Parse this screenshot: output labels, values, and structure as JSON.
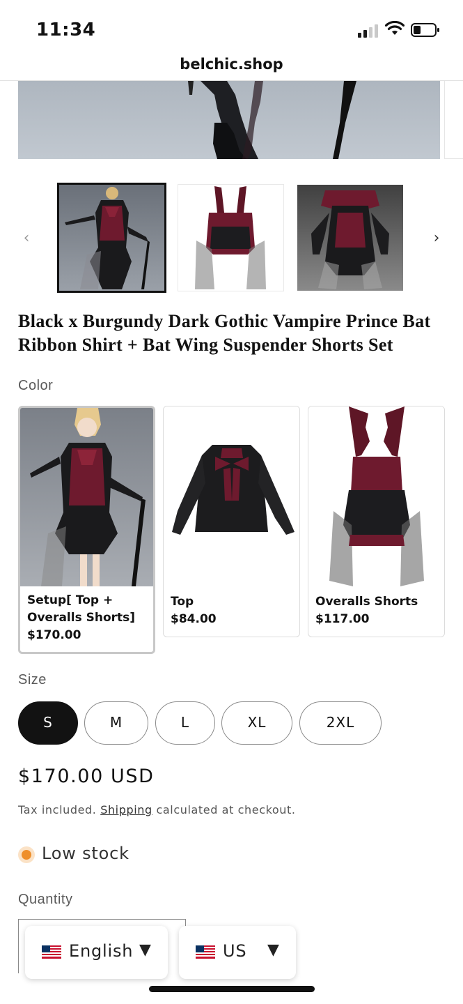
{
  "status_bar": {
    "time": "11:34"
  },
  "browser": {
    "url": "belchic.shop"
  },
  "gallery": {
    "prev_icon": "chevron-left-icon",
    "next_icon": "chevron-right-icon",
    "thumbnails": [
      "thumbnail-1",
      "thumbnail-2",
      "thumbnail-3"
    ]
  },
  "product": {
    "title": "Black x Burgundy Dark Gothic Vampire Prince Bat Ribbon Shirt + Bat Wing Suspender Shorts Set"
  },
  "color": {
    "label": "Color",
    "options": [
      {
        "name": "Setup[ Top + Overalls Shorts]",
        "price": "$170.00",
        "selected": true
      },
      {
        "name": "Top",
        "price": "$84.00",
        "selected": false
      },
      {
        "name": "Overalls Shorts",
        "price": "$117.00",
        "selected": false
      }
    ]
  },
  "size": {
    "label": "Size",
    "options": [
      "S",
      "M",
      "L",
      "XL",
      "2XL"
    ],
    "selected": "S"
  },
  "price": {
    "amount": "$170.00 USD",
    "tax_prefix": "Tax included.",
    "shipping_link": "Shipping",
    "tax_suffix": "calculated at checkout."
  },
  "stock": {
    "text": "Low stock",
    "color": "#ee8f2c"
  },
  "quantity": {
    "label": "Quantity"
  },
  "localization": {
    "language": "English",
    "country": "US",
    "caret": "▼"
  },
  "colors": {
    "accent": "#121212",
    "burgundy": "#6e1a2e",
    "stock_orange": "#ee8f2c"
  }
}
